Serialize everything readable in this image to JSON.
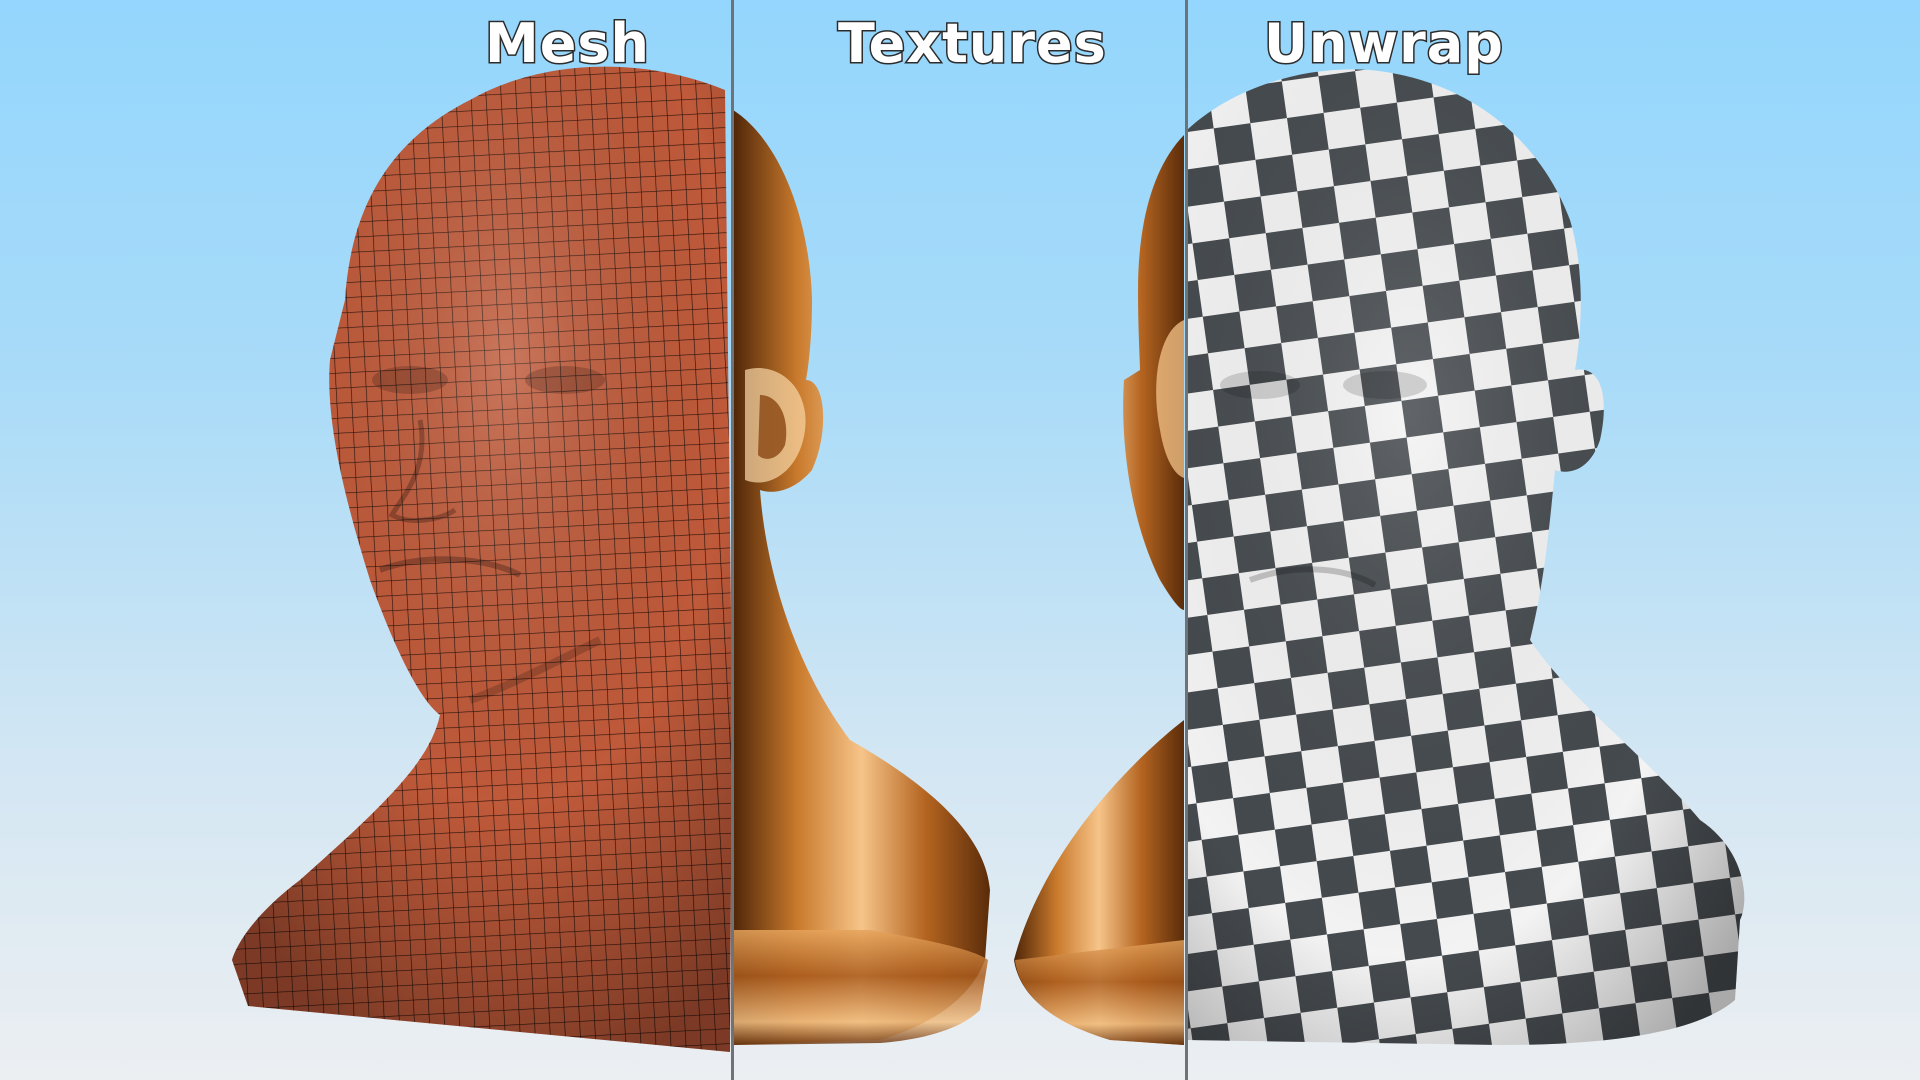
{
  "labels": {
    "mesh": "Mesh",
    "textures": "Textures",
    "unwrap": "Unwrap"
  },
  "colors": {
    "sky_top": "#94d6fd",
    "sky_bottom": "#eceff2",
    "mesh_skin": "#bf5a3a",
    "mesh_wire": "#2a120b",
    "gold_light": "#f6c489",
    "gold_mid": "#c97a2c",
    "gold_dark": "#4f2608",
    "checker_dark": "#454a4e",
    "checker_light": "#f3f3f3",
    "divider": "#6e7378"
  }
}
